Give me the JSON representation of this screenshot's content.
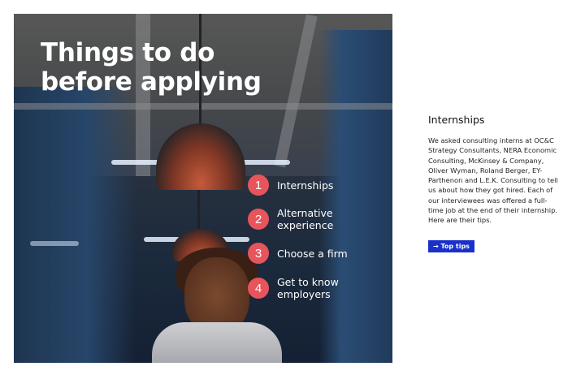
{
  "hero": {
    "title": "Things to do before applying",
    "steps": [
      {
        "number": "1",
        "label": "Internships"
      },
      {
        "number": "2",
        "label": "Alternative experience"
      },
      {
        "number": "3",
        "label": "Choose a firm"
      },
      {
        "number": "4",
        "label": "Get to know employers"
      }
    ],
    "colors": {
      "step_badge": "#e8545c"
    }
  },
  "side_panel": {
    "title": "Internships",
    "body": "We asked consulting interns at OC&C Strategy Consultants, NERA Economic Consulting, McKinsey & Company, Oliver Wyman, Roland Berger, EY-Parthenon and L.E.K. Consulting to tell us about how they got hired. Each of our interviewees was offered a full-time job at the end of their internship. Here are their tips.",
    "button_label": "→ Top tips",
    "colors": {
      "button": "#1930c9"
    }
  }
}
